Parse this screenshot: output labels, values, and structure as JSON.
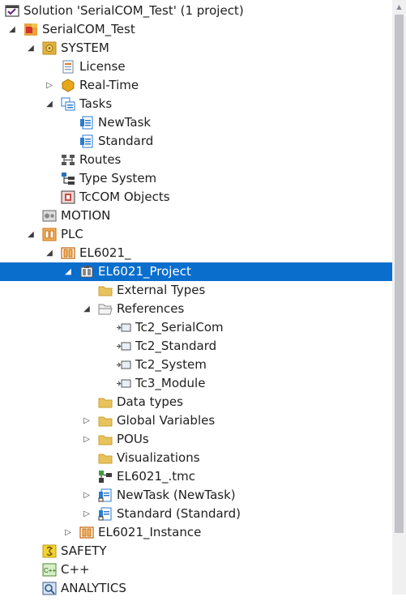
{
  "tree": [
    {
      "label": "Solution 'SerialCOM_Test' (1 project)",
      "level": 0,
      "exp": "none",
      "icon": "vs-solution-icon",
      "selected": false
    },
    {
      "label": "SerialCOM_Test",
      "level": 1,
      "exp": "expanded",
      "icon": "twincat-project-icon",
      "selected": false
    },
    {
      "label": "SYSTEM",
      "level": 2,
      "exp": "expanded",
      "icon": "system-icon",
      "selected": false
    },
    {
      "label": "License",
      "level": 3,
      "exp": "none",
      "icon": "license-icon",
      "selected": false
    },
    {
      "label": "Real-Time",
      "level": 3,
      "exp": "collapsed",
      "icon": "realtime-icon",
      "selected": false
    },
    {
      "label": "Tasks",
      "level": 3,
      "exp": "expanded",
      "icon": "tasks-icon",
      "selected": false
    },
    {
      "label": "NewTask",
      "level": 4,
      "exp": "none",
      "icon": "task-icon",
      "selected": false
    },
    {
      "label": "Standard",
      "level": 4,
      "exp": "none",
      "icon": "task-icon",
      "selected": false
    },
    {
      "label": "Routes",
      "level": 3,
      "exp": "none",
      "icon": "routes-icon",
      "selected": false
    },
    {
      "label": "Type System",
      "level": 3,
      "exp": "none",
      "icon": "type-system-icon",
      "selected": false
    },
    {
      "label": "TcCOM Objects",
      "level": 3,
      "exp": "none",
      "icon": "tccom-icon",
      "selected": false
    },
    {
      "label": "MOTION",
      "level": 2,
      "exp": "none",
      "icon": "motion-icon",
      "selected": false
    },
    {
      "label": "PLC",
      "level": 2,
      "exp": "expanded",
      "icon": "plc-icon",
      "selected": false
    },
    {
      "label": "EL6021_",
      "level": 3,
      "exp": "expanded",
      "icon": "plc-project-icon",
      "selected": false
    },
    {
      "label": "EL6021_Project",
      "level": 4,
      "exp": "expanded",
      "icon": "plc-subproject-icon",
      "selected": true
    },
    {
      "label": "External Types",
      "level": 5,
      "exp": "none",
      "icon": "folder-icon",
      "selected": false
    },
    {
      "label": "References",
      "level": 5,
      "exp": "expanded",
      "icon": "open-folder-icon",
      "selected": false
    },
    {
      "label": "Tc2_SerialCom",
      "level": 6,
      "exp": "none",
      "icon": "reference-icon",
      "selected": false
    },
    {
      "label": "Tc2_Standard",
      "level": 6,
      "exp": "none",
      "icon": "reference-icon",
      "selected": false
    },
    {
      "label": "Tc2_System",
      "level": 6,
      "exp": "none",
      "icon": "reference-icon",
      "selected": false
    },
    {
      "label": "Tc3_Module",
      "level": 6,
      "exp": "none",
      "icon": "reference-icon",
      "selected": false
    },
    {
      "label": "Data types",
      "level": 5,
      "exp": "none",
      "icon": "folder-icon",
      "selected": false
    },
    {
      "label": "Global Variables",
      "level": 5,
      "exp": "collapsed",
      "icon": "folder-icon",
      "selected": false
    },
    {
      "label": "POUs",
      "level": 5,
      "exp": "collapsed",
      "icon": "folder-icon",
      "selected": false
    },
    {
      "label": "Visualizations",
      "level": 5,
      "exp": "none",
      "icon": "folder-icon",
      "selected": false
    },
    {
      "label": "EL6021_.tmc",
      "level": 5,
      "exp": "none",
      "icon": "tmc-icon",
      "selected": false
    },
    {
      "label": "NewTask (NewTask)",
      "level": 5,
      "exp": "collapsed",
      "icon": "task-ref-icon",
      "selected": false
    },
    {
      "label": "Standard (Standard)",
      "level": 5,
      "exp": "collapsed",
      "icon": "task-ref-icon",
      "selected": false
    },
    {
      "label": "EL6021_Instance",
      "level": 4,
      "exp": "collapsed",
      "icon": "plc-instance-icon",
      "selected": false
    },
    {
      "label": "SAFETY",
      "level": 2,
      "exp": "none",
      "icon": "safety-icon",
      "selected": false
    },
    {
      "label": "C++",
      "level": 2,
      "exp": "none",
      "icon": "cpp-icon",
      "selected": false
    },
    {
      "label": "ANALYTICS",
      "level": 2,
      "exp": "none",
      "icon": "analytics-icon",
      "selected": false
    }
  ],
  "colors": {
    "selection": "#0a6ecd",
    "folder": "#e8c25b",
    "text": "#1e1e1e"
  }
}
